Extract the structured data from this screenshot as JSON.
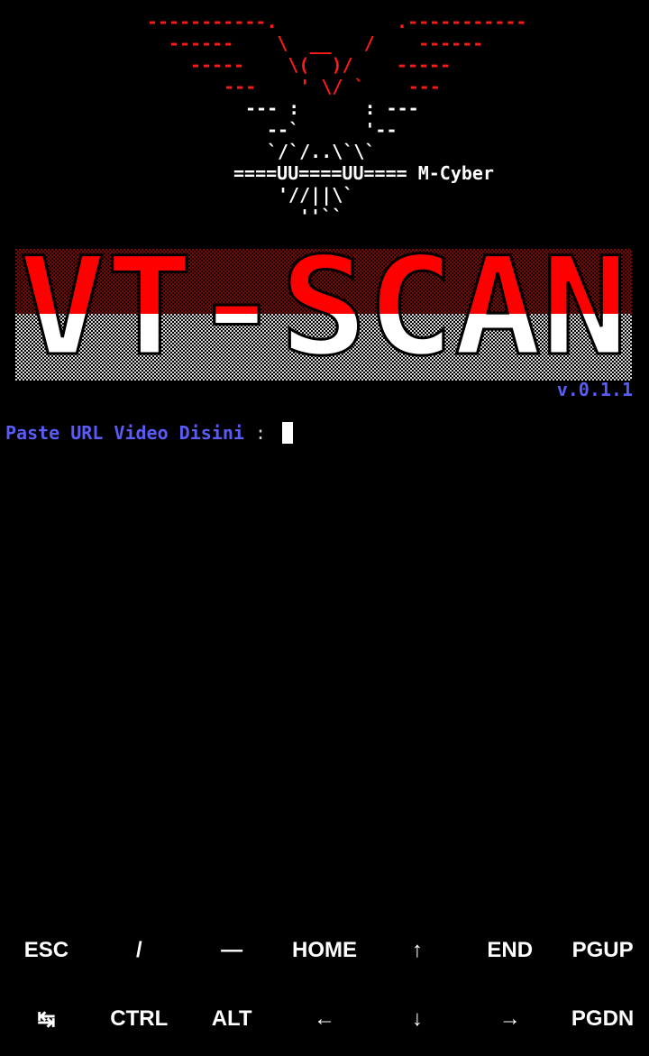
{
  "terminal": {
    "eagle": {
      "line1": "-----------.           .-----------",
      "line2": "------    \\  __   /    ------",
      "line3": "-----    \\(  )/    -----",
      "line4": "---    ' \\/ `    ---",
      "line5": "--- :      : ---",
      "line6": "--`      '--",
      "line7": "`/`/..\\`\\`",
      "line8": "====UU====UU==== M-Cyber",
      "line9": "'//||\\`",
      "line10": "''``"
    },
    "banner_text": "VT-SCAN",
    "version": "v.0.1.1",
    "prompt_label": "Paste URL Video Disini",
    "prompt_separator": " : "
  },
  "extra_keys": {
    "row1": [
      "ESC",
      "/",
      "—",
      "HOME",
      "↑",
      "END",
      "PGUP"
    ],
    "row2": [
      "↹",
      "CTRL",
      "ALT",
      "←",
      "↓",
      "→",
      "PGDN"
    ]
  },
  "colors": {
    "background": "#000000",
    "banner_red": "#ff0000",
    "banner_white": "#ffffff",
    "accent_blue": "#5a5cf5"
  }
}
